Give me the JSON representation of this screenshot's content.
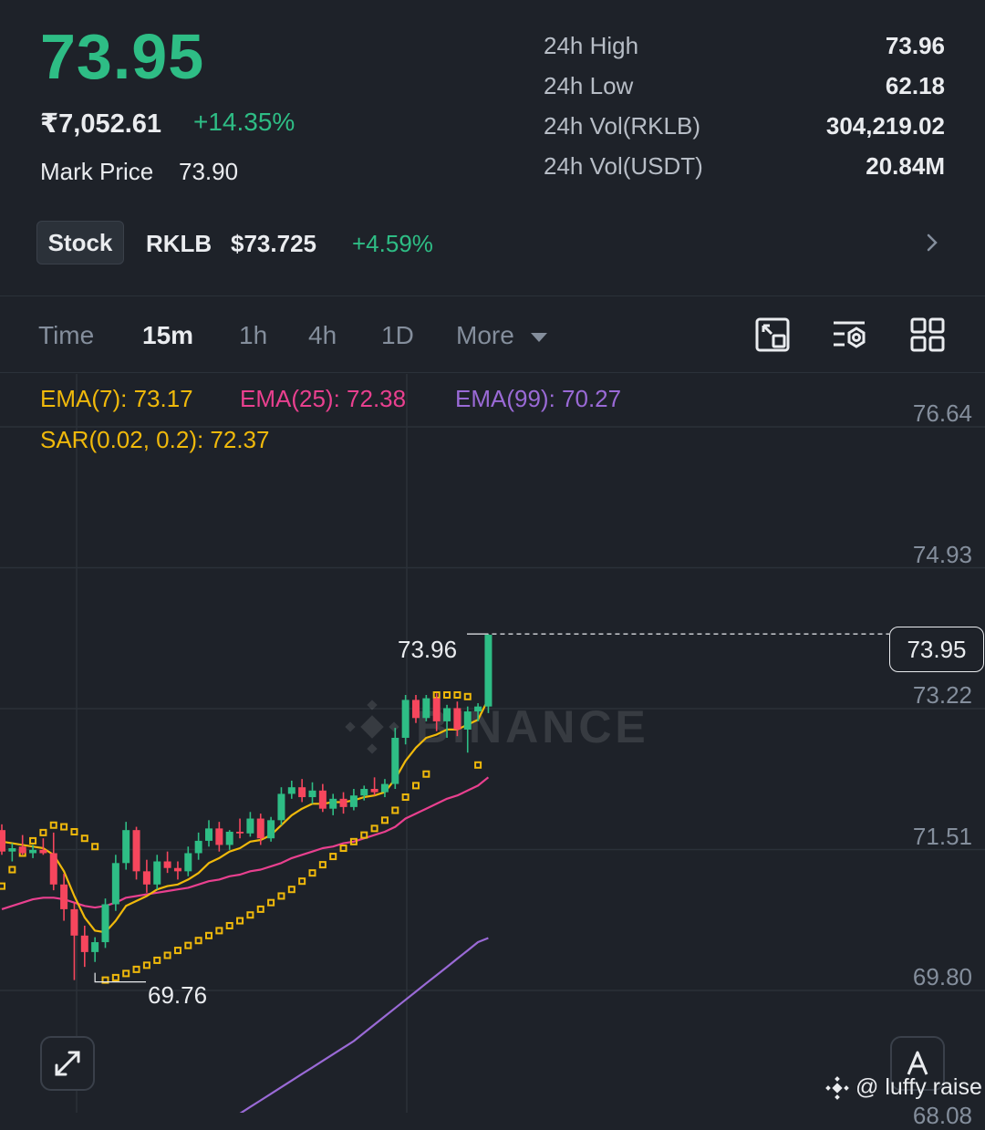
{
  "header": {
    "last_price": "73.95",
    "fiat_price": "₹7,052.61",
    "change_pct": "+14.35%",
    "mark_price_label": "Mark Price",
    "mark_price_value": "73.90"
  },
  "stats": [
    {
      "label": "24h High",
      "value": "73.96"
    },
    {
      "label": "24h Low",
      "value": "62.18"
    },
    {
      "label": "24h Vol(RKLB)",
      "value": "304,219.02"
    },
    {
      "label": "24h Vol(USDT)",
      "value": "20.84M"
    }
  ],
  "stock": {
    "badge": "Stock",
    "symbol": "RKLB",
    "price": "$73.725",
    "change": "+4.59%"
  },
  "tabs": [
    {
      "label": "Time",
      "active": false
    },
    {
      "label": "15m",
      "active": true
    },
    {
      "label": "1h",
      "active": false
    },
    {
      "label": "4h",
      "active": false
    },
    {
      "label": "1D",
      "active": false
    },
    {
      "label": "More",
      "active": false
    }
  ],
  "indicators": {
    "ema7": "EMA(7): 73.17",
    "ema25": "EMA(25): 72.38",
    "ema99": "EMA(99): 70.27",
    "sar": "SAR(0.02, 0.2): 72.37"
  },
  "colors": {
    "up": "#2ebd85",
    "down": "#f6465d",
    "ema7": "#f0b90b",
    "ema25": "#e9408f",
    "ema99": "#9a6ad6",
    "sar": "#f0b90b",
    "background": "#1e2229"
  },
  "icons": [
    "chart-fullscreen-icon",
    "indicator-settings-icon",
    "grid-layout-icon",
    "expand-icon",
    "auto-scale-icon",
    "chevron-right-icon",
    "dropdown-caret-icon",
    "binance-logo-icon"
  ],
  "watermark": "@ luffy raise",
  "chart_data": {
    "type": "candlestick",
    "interval": "15m",
    "y_axis_ticks": [
      "76.64",
      "74.93",
      "73.22",
      "71.51",
      "69.80",
      "68.08"
    ],
    "ylim": [
      68.08,
      76.64
    ],
    "last_price_label": "73.95",
    "high_marker": "73.96",
    "low_marker": "69.76",
    "candles": [
      {
        "o": 71.58,
        "h": 71.65,
        "l": 71.28,
        "c": 71.32
      },
      {
        "o": 71.32,
        "h": 71.42,
        "l": 71.2,
        "c": 71.36
      },
      {
        "o": 71.38,
        "h": 71.52,
        "l": 71.28,
        "c": 71.3
      },
      {
        "o": 71.3,
        "h": 71.4,
        "l": 71.24,
        "c": 71.34
      },
      {
        "o": 71.34,
        "h": 71.48,
        "l": 71.28,
        "c": 71.3
      },
      {
        "o": 71.3,
        "h": 71.55,
        "l": 70.85,
        "c": 70.92
      },
      {
        "o": 70.92,
        "h": 71.05,
        "l": 70.48,
        "c": 70.62
      },
      {
        "o": 70.62,
        "h": 70.7,
        "l": 69.76,
        "c": 70.3
      },
      {
        "o": 70.3,
        "h": 70.42,
        "l": 69.92,
        "c": 70.1
      },
      {
        "o": 70.1,
        "h": 70.28,
        "l": 69.98,
        "c": 70.22
      },
      {
        "o": 70.22,
        "h": 70.75,
        "l": 70.15,
        "c": 70.68
      },
      {
        "o": 70.68,
        "h": 71.28,
        "l": 70.6,
        "c": 71.18
      },
      {
        "o": 71.18,
        "h": 71.68,
        "l": 71.1,
        "c": 71.58
      },
      {
        "o": 71.58,
        "h": 71.62,
        "l": 70.98,
        "c": 71.08
      },
      {
        "o": 71.08,
        "h": 71.22,
        "l": 70.82,
        "c": 70.92
      },
      {
        "o": 70.92,
        "h": 71.28,
        "l": 70.86,
        "c": 71.2
      },
      {
        "o": 71.2,
        "h": 71.32,
        "l": 71.06,
        "c": 71.12
      },
      {
        "o": 71.12,
        "h": 71.2,
        "l": 70.98,
        "c": 71.08
      },
      {
        "o": 71.08,
        "h": 71.38,
        "l": 71.02,
        "c": 71.3
      },
      {
        "o": 71.3,
        "h": 71.55,
        "l": 71.22,
        "c": 71.45
      },
      {
        "o": 71.45,
        "h": 71.7,
        "l": 71.38,
        "c": 71.6
      },
      {
        "o": 71.6,
        "h": 71.68,
        "l": 71.32,
        "c": 71.4
      },
      {
        "o": 71.4,
        "h": 71.58,
        "l": 71.34,
        "c": 71.56
      },
      {
        "o": 71.56,
        "h": 71.72,
        "l": 71.48,
        "c": 71.54
      },
      {
        "o": 71.54,
        "h": 71.8,
        "l": 71.5,
        "c": 71.72
      },
      {
        "o": 71.72,
        "h": 71.78,
        "l": 71.4,
        "c": 71.48
      },
      {
        "o": 71.48,
        "h": 71.74,
        "l": 71.44,
        "c": 71.7
      },
      {
        "o": 71.7,
        "h": 72.1,
        "l": 71.64,
        "c": 72.02
      },
      {
        "o": 72.02,
        "h": 72.18,
        "l": 71.96,
        "c": 72.1
      },
      {
        "o": 72.1,
        "h": 72.2,
        "l": 71.92,
        "c": 71.98
      },
      {
        "o": 71.98,
        "h": 72.16,
        "l": 71.9,
        "c": 72.06
      },
      {
        "o": 72.06,
        "h": 72.14,
        "l": 71.8,
        "c": 71.84
      },
      {
        "o": 71.84,
        "h": 72.02,
        "l": 71.76,
        "c": 71.96
      },
      {
        "o": 71.96,
        "h": 72.04,
        "l": 71.78,
        "c": 71.86
      },
      {
        "o": 71.86,
        "h": 72.08,
        "l": 71.82,
        "c": 72.0
      },
      {
        "o": 72.0,
        "h": 72.12,
        "l": 71.94,
        "c": 72.08
      },
      {
        "o": 72.08,
        "h": 72.22,
        "l": 72.0,
        "c": 72.04
      },
      {
        "o": 72.04,
        "h": 72.2,
        "l": 71.98,
        "c": 72.14
      },
      {
        "o": 72.14,
        "h": 72.82,
        "l": 72.08,
        "c": 72.7
      },
      {
        "o": 72.7,
        "h": 73.22,
        "l": 72.62,
        "c": 73.16
      },
      {
        "o": 73.16,
        "h": 73.22,
        "l": 72.88,
        "c": 72.94
      },
      {
        "o": 72.94,
        "h": 73.22,
        "l": 72.9,
        "c": 73.18
      },
      {
        "o": 73.18,
        "h": 73.24,
        "l": 72.78,
        "c": 72.9
      },
      {
        "o": 72.9,
        "h": 73.1,
        "l": 72.7,
        "c": 73.06
      },
      {
        "o": 73.06,
        "h": 73.14,
        "l": 72.72,
        "c": 72.8
      },
      {
        "o": 72.8,
        "h": 73.08,
        "l": 72.52,
        "c": 73.02
      },
      {
        "o": 73.02,
        "h": 73.12,
        "l": 72.9,
        "c": 73.08
      },
      {
        "o": 73.08,
        "h": 73.96,
        "l": 73.0,
        "c": 73.95
      }
    ],
    "ema7": [
      71.44,
      71.42,
      71.4,
      71.38,
      71.36,
      71.28,
      71.08,
      70.78,
      70.52,
      70.36,
      70.34,
      70.48,
      70.66,
      70.72,
      70.78,
      70.86,
      70.9,
      70.92,
      70.98,
      71.06,
      71.18,
      71.24,
      71.32,
      71.36,
      71.44,
      71.46,
      71.52,
      71.64,
      71.76,
      71.84,
      71.9,
      71.9,
      71.92,
      71.92,
      71.94,
      71.98,
      72.0,
      72.04,
      72.2,
      72.42,
      72.58,
      72.7,
      72.74,
      72.8,
      72.8,
      72.86,
      72.92,
      73.17
    ],
    "ema25": [
      70.62,
      70.66,
      70.7,
      70.74,
      70.76,
      70.76,
      70.74,
      70.7,
      70.66,
      70.64,
      70.66,
      70.7,
      70.76,
      70.78,
      70.8,
      70.82,
      70.84,
      70.86,
      70.88,
      70.92,
      70.96,
      70.98,
      71.02,
      71.04,
      71.08,
      71.1,
      71.14,
      71.18,
      71.24,
      71.28,
      71.32,
      71.36,
      71.38,
      71.42,
      71.44,
      71.48,
      71.52,
      71.56,
      71.62,
      71.72,
      71.78,
      71.84,
      71.9,
      71.96,
      72.0,
      72.06,
      72.12,
      72.22
    ],
    "ema99": [
      67.9,
      67.98,
      68.06,
      68.14,
      68.22,
      68.3,
      68.38,
      68.46,
      68.54,
      68.62,
      68.7,
      68.78,
      68.86,
      68.94,
      69.02,
      69.12,
      69.22,
      69.32,
      69.42,
      69.52,
      69.62,
      69.72,
      69.82,
      69.92,
      70.02,
      70.12,
      70.22,
      70.27
    ],
    "sar": [
      70.9,
      71.1,
      71.3,
      71.45,
      71.55,
      71.64,
      71.62,
      71.56,
      71.48,
      71.38,
      69.76,
      69.79,
      69.84,
      69.89,
      69.94,
      70.0,
      70.06,
      70.12,
      70.18,
      70.24,
      70.3,
      70.36,
      70.42,
      70.48,
      70.55,
      70.62,
      70.7,
      70.78,
      70.86,
      70.96,
      71.06,
      71.16,
      71.26,
      71.36,
      71.44,
      71.52,
      71.6,
      71.7,
      71.82,
      71.98,
      72.12,
      72.26,
      73.22,
      73.22,
      73.22,
      73.2,
      72.37
    ]
  }
}
